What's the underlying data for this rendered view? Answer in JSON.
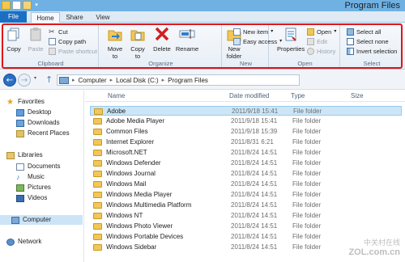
{
  "window": {
    "title": "Program Files"
  },
  "tabs": [
    {
      "label": "File"
    },
    {
      "label": "Home"
    },
    {
      "label": "Share"
    },
    {
      "label": "View"
    }
  ],
  "ribbon": {
    "groups": {
      "clipboard": "Clipboard",
      "organize": "Organize",
      "new": "New",
      "open": "Open",
      "select": "Select"
    },
    "copy": "Copy",
    "paste": "Paste",
    "cut": "Cut",
    "copy_path": "Copy path",
    "paste_shortcut": "Paste shortcut",
    "move_to": "Move to",
    "copy_to": "Copy to",
    "delete": "Delete",
    "rename": "Rename",
    "new_folder": "New folder",
    "new_item": "New item",
    "easy_access": "Easy access",
    "properties": "Properties",
    "open": "Open",
    "edit": "Edit",
    "history": "History",
    "select_all": "Select all",
    "select_none": "Select none",
    "invert_selection": "Invert selection"
  },
  "address": {
    "crumbs": [
      "Computer",
      "Local Disk (C:)",
      "Program Files"
    ]
  },
  "nav": {
    "favorites": "Favorites",
    "desktop": "Desktop",
    "downloads": "Downloads",
    "recent": "Recent Places",
    "libraries": "Libraries",
    "documents": "Documents",
    "music": "Music",
    "pictures": "Pictures",
    "videos": "Videos",
    "computer": "Computer",
    "network": "Network"
  },
  "columns": {
    "name": "Name",
    "date": "Date modified",
    "type": "Type",
    "size": "Size"
  },
  "files": [
    {
      "name": "Adobe",
      "date": "2011/9/18 15:41",
      "type": "File folder"
    },
    {
      "name": "Adobe Media Player",
      "date": "2011/9/18 15:41",
      "type": "File folder"
    },
    {
      "name": "Common Files",
      "date": "2011/9/18 15:39",
      "type": "File folder"
    },
    {
      "name": "Internet Explorer",
      "date": "2011/8/31 6:21",
      "type": "File folder"
    },
    {
      "name": "Microsoft.NET",
      "date": "2011/8/24 14:51",
      "type": "File folder"
    },
    {
      "name": "Windows Defender",
      "date": "2011/8/24 14:51",
      "type": "File folder"
    },
    {
      "name": "Windows Journal",
      "date": "2011/8/24 14:51",
      "type": "File folder"
    },
    {
      "name": "Windows Mail",
      "date": "2011/8/24 14:51",
      "type": "File folder"
    },
    {
      "name": "Windows Media Player",
      "date": "2011/8/24 14:51",
      "type": "File folder"
    },
    {
      "name": "Windows Multimedia Platform",
      "date": "2011/8/24 14:51",
      "type": "File folder"
    },
    {
      "name": "Windows NT",
      "date": "2011/8/24 14:51",
      "type": "File folder"
    },
    {
      "name": "Windows Photo Viewer",
      "date": "2011/8/24 14:51",
      "type": "File folder"
    },
    {
      "name": "Windows Portable Devices",
      "date": "2011/8/24 14:51",
      "type": "File folder"
    },
    {
      "name": "Windows Sidebar",
      "date": "2011/8/24 14:51",
      "type": "File folder"
    }
  ],
  "watermark": {
    "line1": "中关村在线",
    "line2": "ZOL.com.cn"
  }
}
